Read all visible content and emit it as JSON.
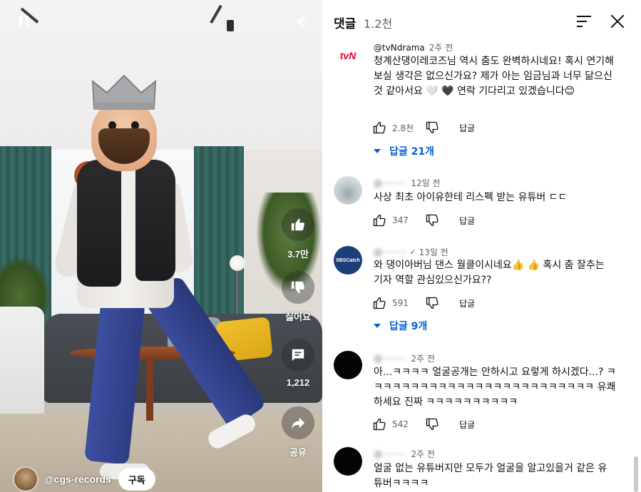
{
  "video": {
    "channel_name": "@cgs-records",
    "subscribe_label": "구독",
    "like_count": "3.7만",
    "dislike_label": "싫어요",
    "comment_count": "1,212",
    "share_label": "공유"
  },
  "comments_panel": {
    "title": "댓글",
    "count": "1.2천",
    "accent_color": "#065fd4",
    "reply_label": "답글",
    "comments": [
      {
        "author": "@tvNdrama",
        "time": "2주 전",
        "avatar_icon": "tvn-logo",
        "avatar_text": "tvN",
        "text": "청계산댕이레코즈님 역시 춤도 완벽하시네요! 혹시 연기해 보실 생각은 없으신가요? 제가 아는 임금님과 너무 닮으신 것 같아서요 🤍 🖤 연락 기다리고 있겠습니다😊",
        "likes": "2.8천",
        "replies": "답글 21개"
      },
      {
        "author": "@·········",
        "time": "12일 전",
        "avatar_icon": "landscape-avatar",
        "text": "사상 최초 아이유한테 리스펙 받는 유튜버 ㄷㄷ",
        "likes": "347",
        "replies": ""
      },
      {
        "author": "@·········",
        "time": "13일 전",
        "avatar_icon": "sbs-catch-logo",
        "avatar_text": "SBSCatch",
        "text": "와 댕이아버님 댄스 월클이시네요👍 👍 혹시 춤 잘추는 기자 역할 관심있으신가요??",
        "likes": "591",
        "replies": "답글 9개"
      },
      {
        "author": "@·········",
        "time": "2주 전",
        "avatar_icon": "black-avatar",
        "text": "아...ㅋㅋㅋㅋ 얼굴공개는 안하시고 요렇게 하시겠다...? ㅋㅋㅋㅋㅋㅋㅋㅋㅋㅋㅋㅋㅋㅋㅋㅋㅋㅋㅋㅋㅋㅋㅋㅋㅋ 유쾌하세요 진짜 ㅋㅋㅋㅋㅋㅋㅋㅋㅋㅋ",
        "likes": "542",
        "replies": ""
      },
      {
        "author": "@·········",
        "time": "2주 전",
        "avatar_icon": "black-avatar",
        "text": "얼굴 없는 유튜버지만 모두가 얼굴을 알고있을거 같은 유튜버ㅋㅋㅋㅋ",
        "likes": "",
        "replies": ""
      }
    ]
  }
}
